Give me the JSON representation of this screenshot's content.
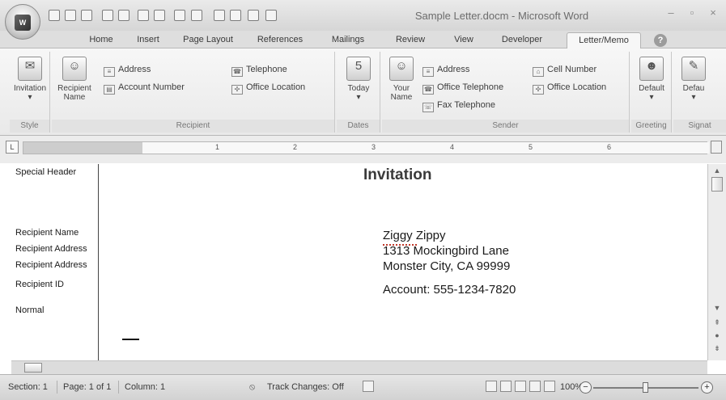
{
  "window": {
    "title": "Sample Letter.docm - Microsoft Word",
    "minimize": "–",
    "maximize": "▫",
    "close": "×"
  },
  "office_button": {
    "logo_text": "W"
  },
  "tabs": [
    {
      "label": "Home"
    },
    {
      "label": "Insert"
    },
    {
      "label": "Page Layout"
    },
    {
      "label": "References"
    },
    {
      "label": "Mailings"
    },
    {
      "label": "Review"
    },
    {
      "label": "View"
    },
    {
      "label": "Developer"
    },
    {
      "label": "Letter/Memo",
      "active": true
    }
  ],
  "ribbon": {
    "style_group": {
      "label": "Style",
      "invitation": "Invitation"
    },
    "recipient_group": {
      "label": "Recipient",
      "recipient_name": "Recipient Name",
      "address": "Address",
      "account_number": "Account Number",
      "telephone": "Telephone",
      "office_location": "Office Location"
    },
    "dates_group": {
      "label": "Dates",
      "today": "Today"
    },
    "sender_group": {
      "label": "Sender",
      "your_name": "Your Name",
      "address": "Address",
      "office_telephone": "Office Telephone",
      "fax_telephone": "Fax Telephone",
      "cell_number": "Cell Number",
      "office_location": "Office Location"
    },
    "greeting_group": {
      "label": "Greeting",
      "default": "Default"
    },
    "signature_group": {
      "label": "Signat",
      "default": "Defau"
    }
  },
  "ruler": {
    "numbers": [
      "1",
      "2",
      "3",
      "4",
      "5",
      "6"
    ]
  },
  "style_pane": {
    "items": [
      "Special Header",
      "Recipient Name",
      "Recipient Address",
      "Recipient Address",
      "Recipient ID",
      "Normal"
    ]
  },
  "document": {
    "heading": "Invitation",
    "lines": [
      "Ziggy Zippy",
      "1313 Mockingbird Lane",
      "Monster City, CA 99999",
      "Account: 555-1234-7820"
    ]
  },
  "status": {
    "section": "Section: 1",
    "page": "Page: 1 of 1",
    "column": "Column: 1",
    "track_changes": "Track Changes: Off",
    "zoom": "100%",
    "zoom_level_percent": 100
  },
  "icons": {
    "save": "save-icon",
    "undo": "undo-icon",
    "redo": "redo-icon",
    "help": "help-icon",
    "address": "address-icon",
    "telephone": "telephone-icon"
  }
}
